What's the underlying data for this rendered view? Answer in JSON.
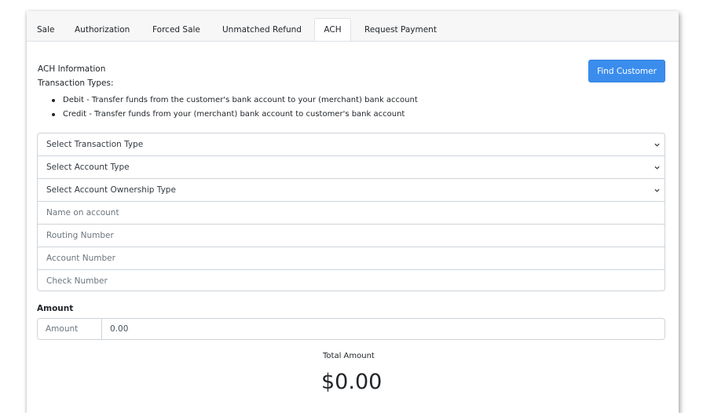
{
  "tabs": [
    {
      "label": "Sale",
      "active": false
    },
    {
      "label": "Authorization",
      "active": false
    },
    {
      "label": "Forced Sale",
      "active": false
    },
    {
      "label": "Unmatched Refund",
      "active": false
    },
    {
      "label": "ACH",
      "active": true
    },
    {
      "label": "Request Payment",
      "active": false
    }
  ],
  "ach": {
    "title": "ACH Information",
    "types_label": "Transaction Types:",
    "bullets": [
      "Debit - Transfer funds from the customer's bank account to your (merchant) bank account",
      "Credit - Transfer funds from your (merchant) bank account to customer's bank account"
    ],
    "find_customer_label": "Find Customer"
  },
  "form": {
    "transaction_type": "Select Transaction Type",
    "account_type": "Select Account Type",
    "ownership_type": "Select Account Ownership Type",
    "name_placeholder": "Name on account",
    "routing_placeholder": "Routing Number",
    "account_placeholder": "Account Number",
    "check_placeholder": "Check Number"
  },
  "amount": {
    "label": "Amount",
    "addon": "Amount",
    "value": "0.00"
  },
  "total": {
    "label": "Total Amount",
    "value": "$0.00"
  },
  "colors": {
    "primary": "#3b8ded",
    "tabbar": "#f7f7f8",
    "border": "#ced4da"
  },
  "icons": {
    "dropdown": "chevron-down-icon"
  }
}
